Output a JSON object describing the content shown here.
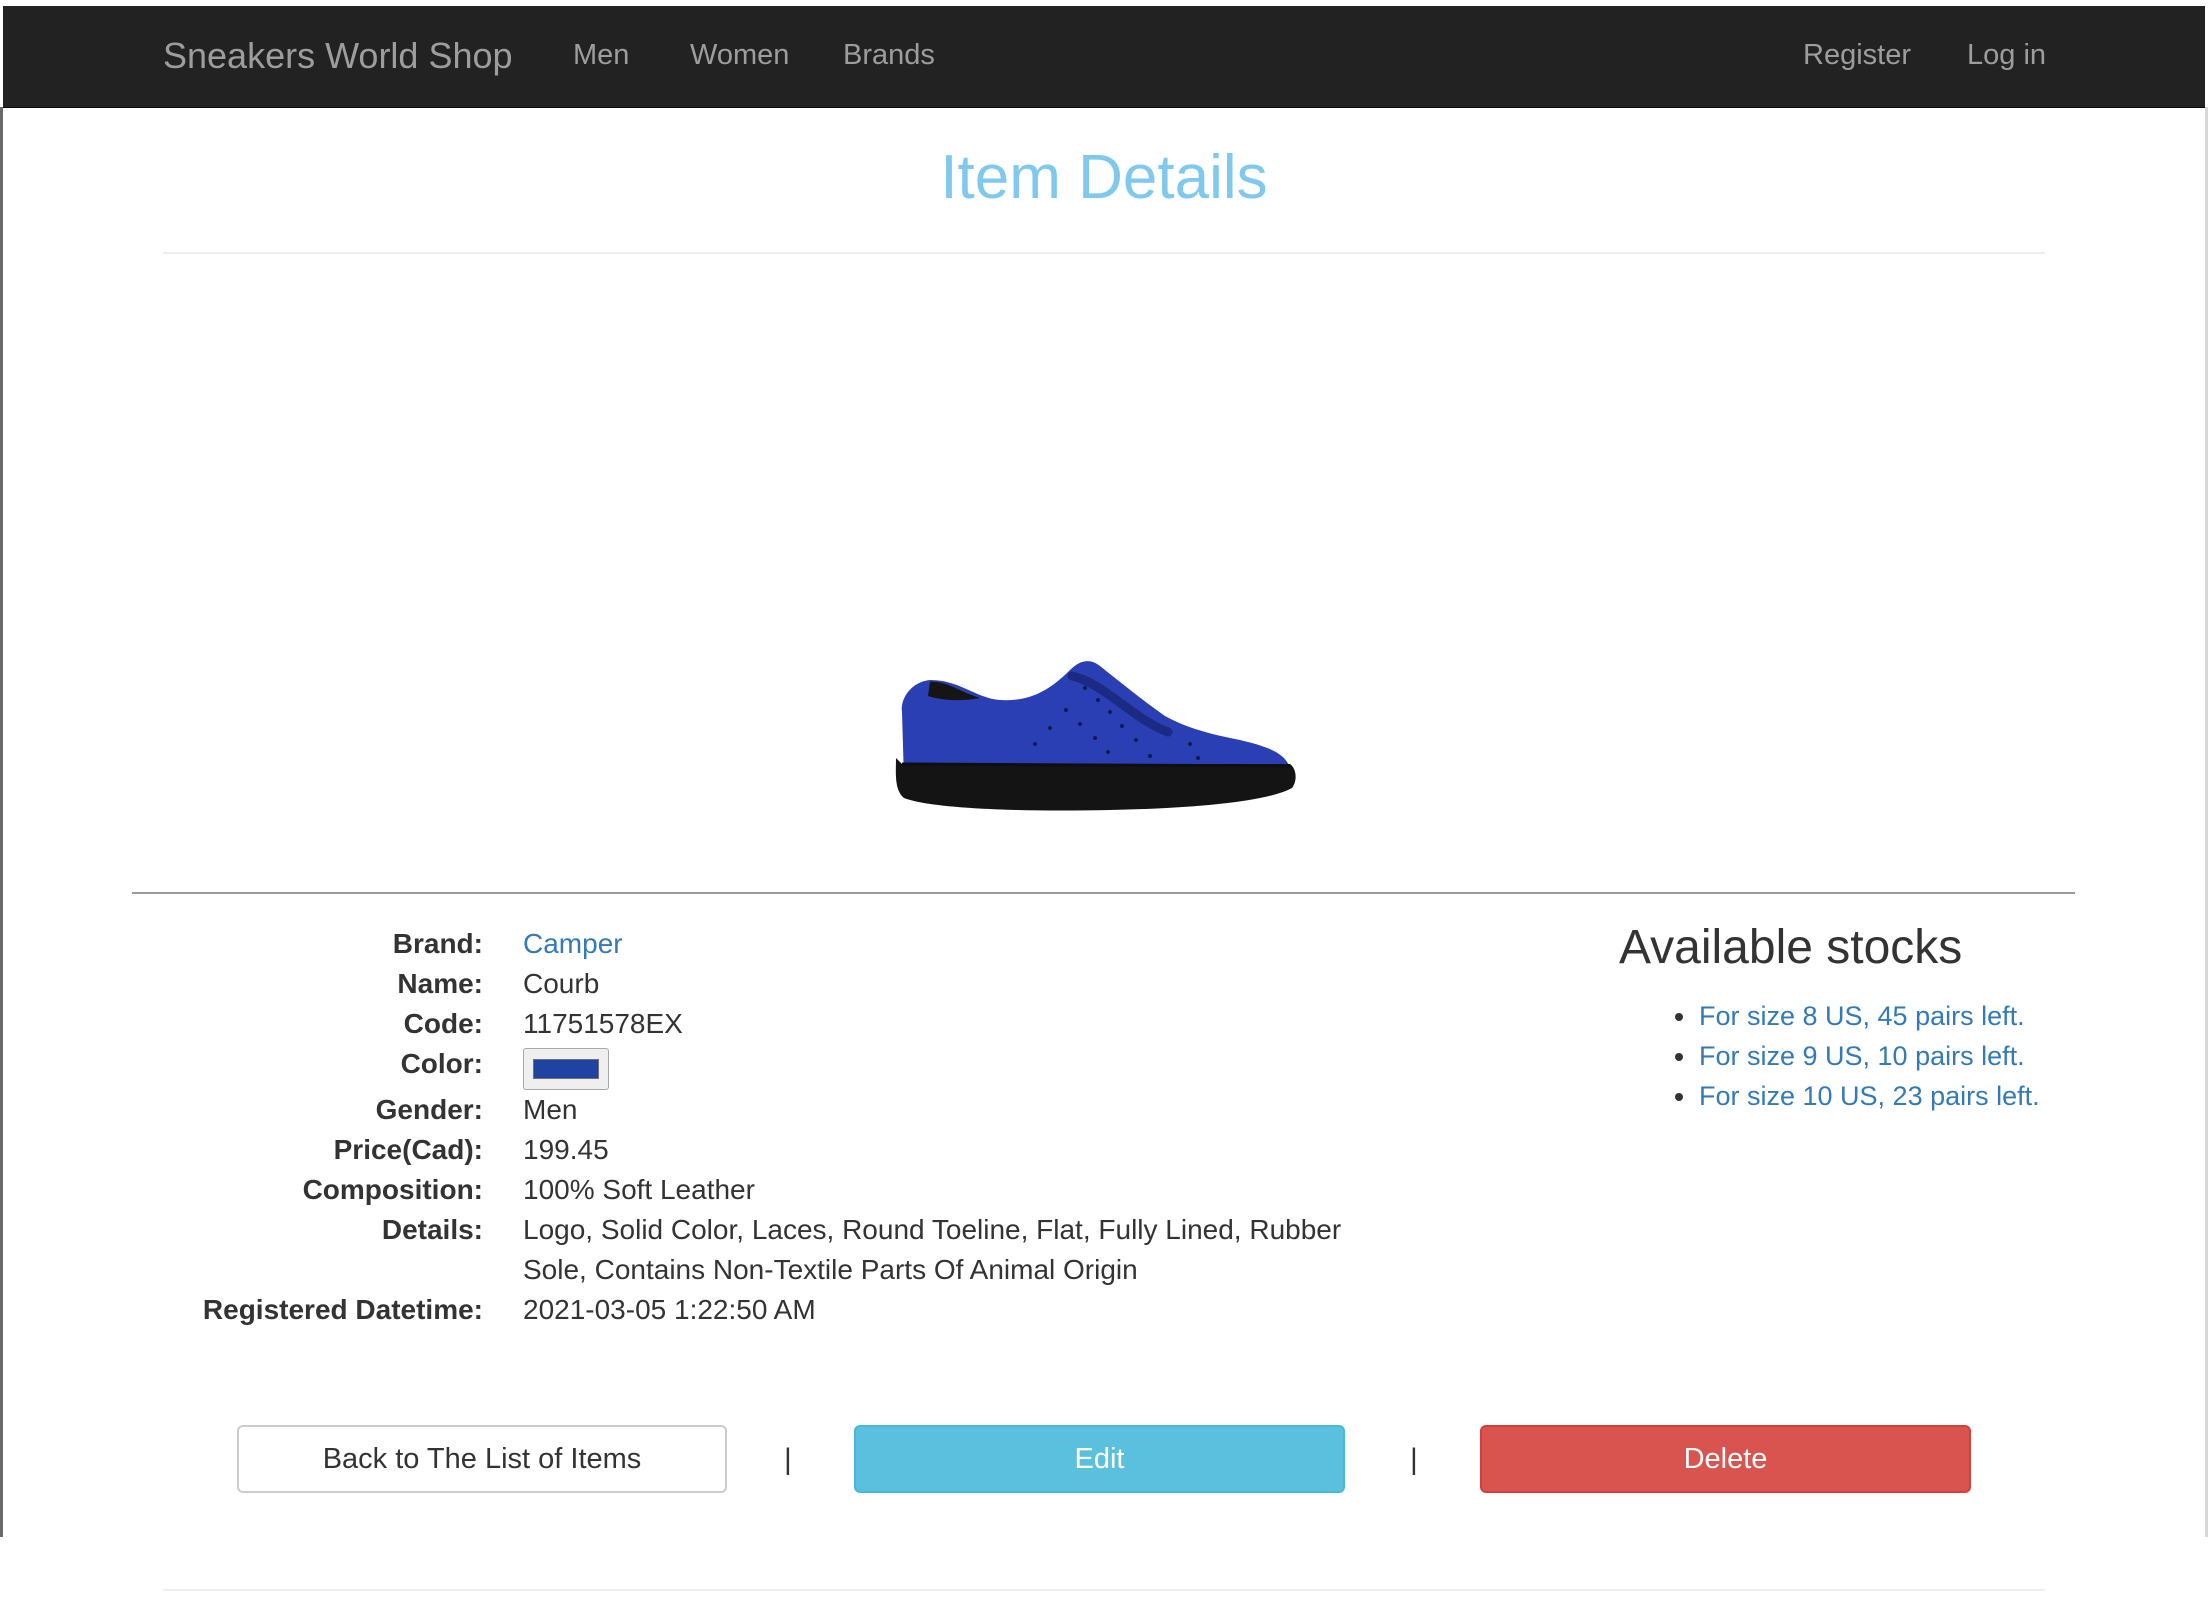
{
  "navbar": {
    "brand": "Sneakers World Shop",
    "links": [
      "Men",
      "Women",
      "Brands"
    ],
    "register": "Register",
    "login": "Log in"
  },
  "page": {
    "title": "Item Details"
  },
  "image": {
    "icon": "shoe-image",
    "shoe_color": "#2a3fb3"
  },
  "details": {
    "brand_label": "Brand:",
    "brand": "Camper",
    "name_label": "Name:",
    "name": "Courb",
    "code_label": "Code:",
    "code": "11751578EX",
    "color_label": "Color:",
    "color_value": "#1f43a0",
    "gender_label": "Gender:",
    "gender": "Men",
    "price_label": "Price(Cad):",
    "price": "199.45",
    "composition_label": "Composition:",
    "composition": "100% Soft Leather",
    "details_label": "Details:",
    "details_text": "Logo, Solid Color, Laces, Round Toeline, Flat, Fully Lined, Rubber Sole, Contains Non-Textile Parts Of Animal Origin",
    "registered_label": "Registered Datetime:",
    "registered": "2021-03-05 1:22:50 AM"
  },
  "stocks": {
    "title": "Available stocks",
    "items": [
      "For size 8 US, 45 pairs left.",
      "For size 9 US, 10 pairs left.",
      "For size 10 US, 23 pairs left."
    ]
  },
  "actions": {
    "back": "Back to The List of Items",
    "separator": "|",
    "edit": "Edit",
    "delete": "Delete"
  }
}
